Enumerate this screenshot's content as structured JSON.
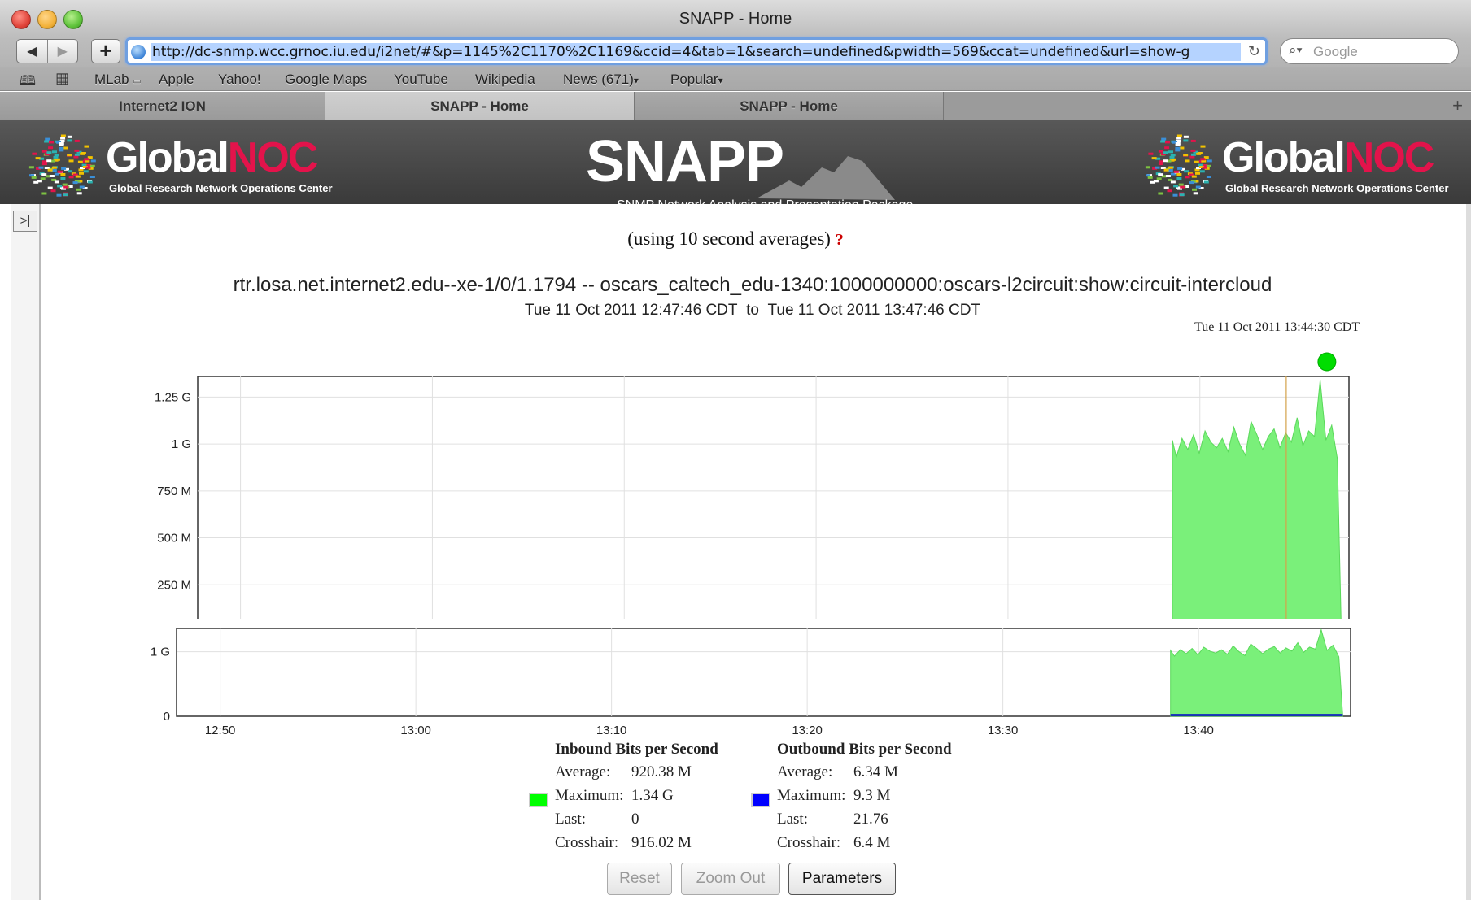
{
  "window": {
    "title": "SNAPP - Home"
  },
  "toolbar": {
    "url": "http://dc-snmp.wcc.grnoc.iu.edu/i2net/#&p=1145%2C1170%2C1169&ccid=4&tab=1&search=undefined&pwidth=569&ccat=undefined&url=show-g",
    "search_placeholder": "Google"
  },
  "bookmarks": [
    "MLab",
    "Apple",
    "Yahoo!",
    "Google Maps",
    "YouTube",
    "Wikipedia",
    "News (671)",
    "Popular"
  ],
  "tabs": [
    {
      "label": "Internet2 ION",
      "active": false
    },
    {
      "label": "SNAPP - Home",
      "active": true
    },
    {
      "label": "SNAPP - Home",
      "active": false
    }
  ],
  "header": {
    "gnoc_name_a": "Global",
    "gnoc_name_b": "NOC",
    "gnoc_sub": "Global Research Network Operations Center",
    "snapp": "SNAPP",
    "snapp_sub": "SNMP Network Analysis and Presentation Package"
  },
  "page": {
    "averages_note": "(using 10 second averages)",
    "help_mark": "?",
    "graph_title": "rtr.losa.net.internet2.edu--xe-1/0/1.1794 -- oscars_caltech_edu-1340:1000000000:oscars-l2circuit:show:circuit-intercloud",
    "range_from": "Tue 11 Oct 2011 12:47:46 CDT",
    "range_to_word": "to",
    "range_to": "Tue 11 Oct 2011 13:47:46 CDT",
    "crosshair_time": "Tue 11 Oct 2011 13:44:30 CDT"
  },
  "chart_data": [
    {
      "type": "area",
      "x_ticks": [
        "12:50",
        "13:00",
        "13:10",
        "13:20",
        "13:30",
        "13:40"
      ],
      "y_ticks": [
        "0",
        "250 M",
        "500 M",
        "750 M",
        "1 G",
        "1.25 G"
      ],
      "ylim": [
        0,
        1.36
      ],
      "y_unit": "G",
      "x_range_minutes": [
        0,
        60
      ],
      "grid": true,
      "series": [
        {
          "name": "Inbound Bits per Second",
          "color": "#7af07a",
          "x": [
            50.8,
            51.0,
            51.3,
            51.6,
            51.9,
            52.2,
            52.5,
            52.8,
            53.1,
            53.4,
            53.7,
            54.0,
            54.3,
            54.6,
            54.9,
            55.2,
            55.5,
            55.8,
            56.1,
            56.4,
            56.7,
            57.0,
            57.3,
            57.6,
            57.9,
            58.2,
            58.5,
            58.8,
            59.1,
            59.4,
            59.6
          ],
          "values": [
            1.02,
            0.93,
            1.03,
            0.97,
            1.05,
            0.95,
            1.07,
            1.01,
            0.98,
            1.03,
            0.96,
            1.09,
            1.0,
            0.94,
            1.12,
            1.05,
            0.97,
            1.04,
            1.08,
            0.98,
            1.06,
            1.01,
            1.14,
            0.99,
            1.07,
            1.04,
            1.34,
            1.02,
            1.1,
            0.92,
            0.0
          ]
        },
        {
          "name": "Outbound Bits per Second",
          "color": "#0000cc",
          "x": [
            50.8,
            59.6
          ],
          "values": [
            0.006,
            0.006
          ]
        }
      ]
    },
    {
      "type": "area",
      "x_ticks": [
        "12:50",
        "13:00",
        "13:10",
        "13:20",
        "13:30",
        "13:40"
      ],
      "y_ticks": [
        "0",
        "1 G"
      ],
      "ylim": [
        0,
        1.36
      ],
      "grid": true
    }
  ],
  "legend": {
    "inbound": {
      "title": "Inbound Bits per Second",
      "color": "#00ff00",
      "rows": [
        {
          "k": "Average:",
          "v": "920.38 M"
        },
        {
          "k": "Maximum:",
          "v": "1.34 G"
        },
        {
          "k": "Last:",
          "v": "0"
        },
        {
          "k": "Crosshair:",
          "v": "916.02 M"
        }
      ]
    },
    "outbound": {
      "title": "Outbound Bits per Second",
      "color": "#0000ff",
      "rows": [
        {
          "k": "Average:",
          "v": "6.34 M"
        },
        {
          "k": "Maximum:",
          "v": "9.3 M"
        },
        {
          "k": "Last:",
          "v": "21.76"
        },
        {
          "k": "Crosshair:",
          "v": "6.4 M"
        }
      ]
    }
  },
  "buttons": {
    "reset": "Reset",
    "zoom_out": "Zoom Out",
    "parameters": "Parameters"
  }
}
